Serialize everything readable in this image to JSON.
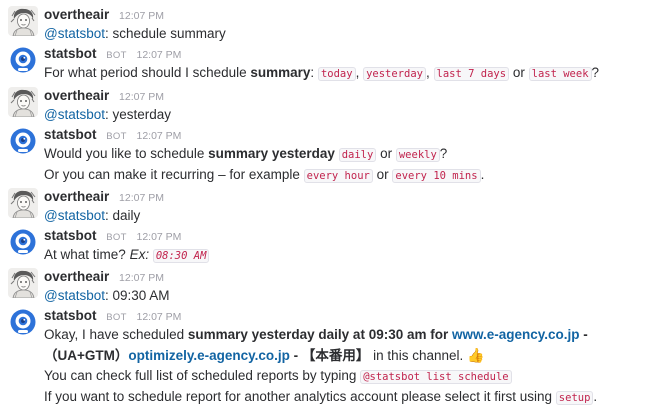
{
  "messages": [
    {
      "user": "overtheair",
      "time": "12:07 PM",
      "mention": "@statsbot",
      "text": ": schedule summary"
    },
    {
      "user": "statsbot",
      "bot_badge": "BOT",
      "time": "12:07 PM",
      "q_prefix": "For what period should I schedule ",
      "q_bold": "summary",
      "q_colon": ":",
      "options": [
        "today",
        "yesterday",
        "last 7 days",
        "last week"
      ],
      "sep_comma": ",",
      "sep_or": "or",
      "q_end": "?"
    },
    {
      "user": "overtheair",
      "time": "12:07 PM",
      "mention": "@statsbot",
      "text": ": yesterday"
    },
    {
      "user": "statsbot",
      "bot_badge": "BOT",
      "time": "12:07 PM",
      "l1_prefix": "Would you like to schedule ",
      "l1_bold": "summary yesterday",
      "l1_opt1": "daily",
      "l1_or": "or",
      "l1_opt2": "weekly",
      "l1_end": "?",
      "l2_prefix": "Or you can make it recurring –  for example",
      "l2_opt1": "every hour",
      "l2_or": "or",
      "l2_opt2": "every 10 mins",
      "l2_end": "."
    },
    {
      "user": "overtheair",
      "time": "12:07 PM",
      "mention": "@statsbot",
      "text": ": daily"
    },
    {
      "user": "statsbot",
      "bot_badge": "BOT",
      "time": "12:07 PM",
      "prefix": "At what time?",
      "ex": "Ex:",
      "example": "08:30 AM"
    },
    {
      "user": "overtheair",
      "time": "12:07 PM",
      "mention": "@statsbot",
      "text": ": 09:30 AM"
    },
    {
      "user": "statsbot",
      "bot_badge": "BOT",
      "time": "12:07 PM",
      "l1_prefix": "Okay, I have scheduled ",
      "l1_bold": "summary yesterday daily at 09:30 am for ",
      "l1_link": "www.e-agency.co.jp",
      "l1_dash": " -",
      "l2_bold1": "（UA+GTM）",
      "l2_link": "optimizely.e-agency.co.jp",
      "l2_bold2": " - 【本番用】",
      "l2_text": " in this channel.",
      "l2_emoji": "👍",
      "l3_prefix": "You can check full list of scheduled reports by typing",
      "l3_code": "@statsbot list schedule",
      "l4_prefix": "If you want to schedule report for another analytics account please select it first using",
      "l4_code": "setup",
      "l4_end": "."
    }
  ],
  "colors": {
    "code_text": "#c1234d",
    "link": "#1264a3",
    "bot_avatar": "#2d72d9"
  },
  "icons": {
    "user_avatar": "user-sketch-avatar-icon",
    "bot_avatar": "robot-avatar-icon"
  }
}
